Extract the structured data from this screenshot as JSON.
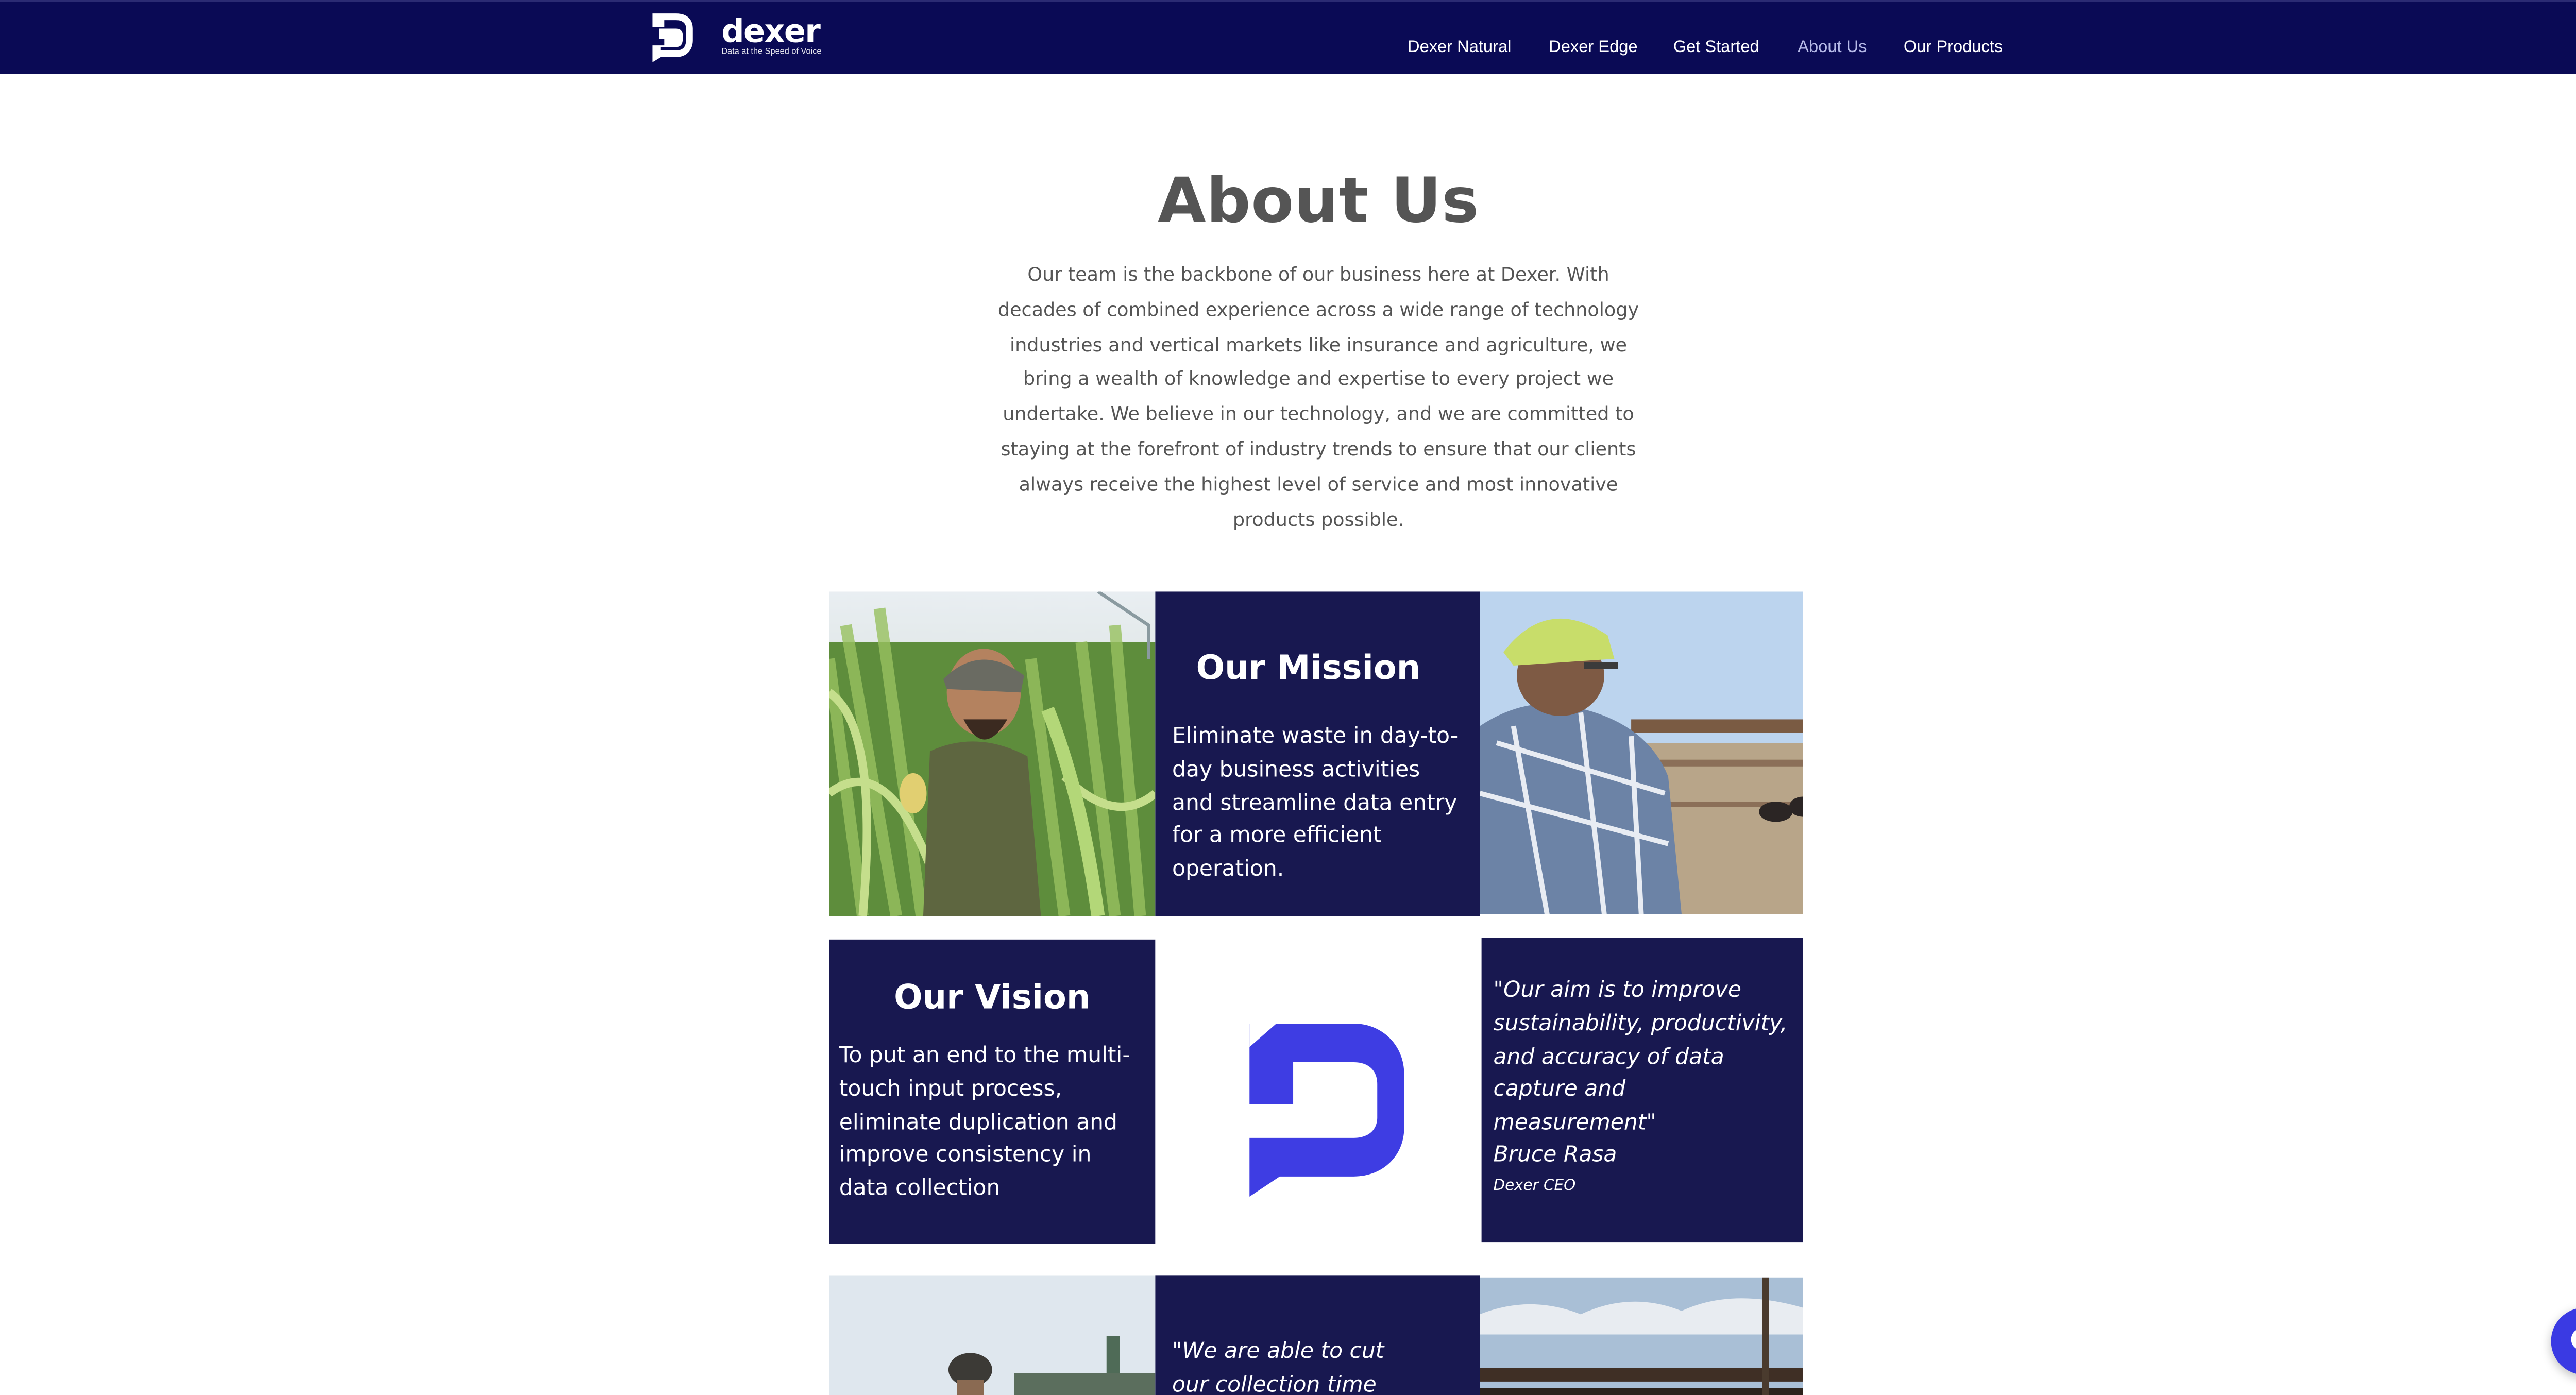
{
  "header": {
    "brand_name": "dexer",
    "brand_tagline": "Data at the Speed of Voice",
    "nav": [
      {
        "label": "Dexer Natural"
      },
      {
        "label": "Dexer Edge"
      },
      {
        "label": "Get Started"
      },
      {
        "label": "About Us",
        "active": true
      },
      {
        "label": "Our Products"
      }
    ]
  },
  "main": {
    "title": "About Us",
    "intro": "Our team is the backbone of our business here at Dexer. With decades of combined experience across a wide range of technology industries and vertical markets like insurance and agriculture, we bring a wealth of knowledge and expertise to every project we undertake. We believe in our technology, and we are committed to staying at the forefront of industry trends to ensure that our clients always receive the highest level of service and most innovative products possible.",
    "mission": {
      "heading": "Our Mission",
      "body": "Eliminate waste in day-to-day business activities and streamline data entry for a more efficient operation."
    },
    "vision": {
      "heading": "Our Vision",
      "body": "To put an end to the multi-touch input process, eliminate duplication and improve consistency in data collection"
    },
    "testimonial_ceo": {
      "quote": "\"Our aim is to improve sustainability, productivity, and accuracy of data capture and measurement\"",
      "name": "Bruce Rasa",
      "role": "Dexer CEO"
    },
    "testimonial_partial": {
      "quote": "\"We are able to cut our collection time down by"
    }
  },
  "icons": [
    "dexer-logo-icon",
    "chat-bubble-icon"
  ],
  "colors": {
    "navy": "#0a0a55",
    "tile_navy": "#181850",
    "accent": "#3a3ae3",
    "text_grey": "#555555"
  }
}
